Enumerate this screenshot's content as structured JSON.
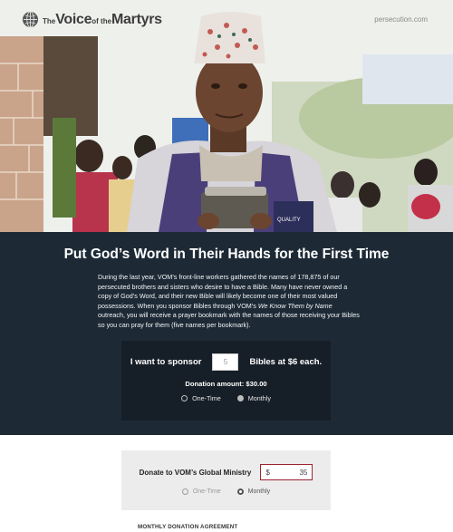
{
  "header": {
    "logo_small": "The",
    "logo_voice": "Voice",
    "logo_of_the": "of the",
    "logo_martyrs": "Martyrs",
    "site_url": "persecution.com"
  },
  "hero": {
    "image_subject": "man-holding-bible",
    "colors": {
      "dark_panel": "#1d2a36",
      "sponsor_box": "#161e27",
      "accent_border": "#9b2332"
    }
  },
  "campaign": {
    "headline": "Put God’s Word in Their Hands for the First Time",
    "intro_1": "During the last year, VOM’s front-line workers gathered the names of 178,875 of our persecuted brothers and sisters who desire to have a Bible. Many have never owned a copy of God’s Word, and their new Bible will likely become one of their most valued possessions. When you sponsor Bibles through VOM’s ",
    "intro_em": "We Know Them by Name",
    "intro_2": " outreach, you will receive a prayer bookmark with the names of those receiving your Bibles so you can pray for them (five names per bookmark)."
  },
  "sponsor": {
    "prefix": "I want to sponsor",
    "quantity": "5",
    "suffix": "Bibles at $6 each.",
    "donation_amount": "Donation amount: $30.00",
    "options": [
      {
        "label": "One-Time",
        "selected": false
      },
      {
        "label": "Monthly",
        "selected": true
      }
    ]
  },
  "ministry": {
    "label": "Donate to VOM’s Global Ministry",
    "currency": "$",
    "amount": "35",
    "options": [
      {
        "label": "One-Time",
        "selected": false
      },
      {
        "label": "Monthly",
        "selected": true
      }
    ]
  },
  "agreement_title": "MONTHLY DONATION AGREEMENT"
}
